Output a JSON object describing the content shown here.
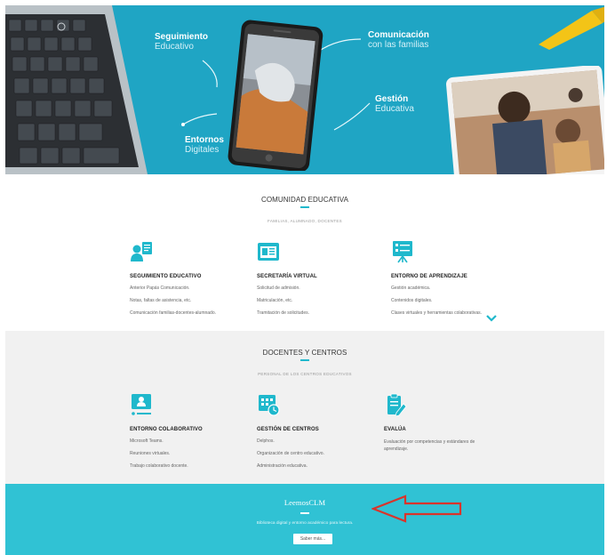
{
  "hero": {
    "labels": [
      {
        "strong": "Seguimiento",
        "light": "Educativo"
      },
      {
        "strong": "Comunicación",
        "light": "con las familias"
      },
      {
        "strong": "Gestión",
        "light": "Educativa"
      },
      {
        "strong": "Entornos",
        "light": "Digitales"
      }
    ]
  },
  "comunidad": {
    "title": "COMUNIDAD EDUCATIVA",
    "subtitle": "FAMILIAS, ALUMNADO, DOCENTES",
    "columns": [
      {
        "icon": "student-profile-icon",
        "title": "SEGUIMIENTO EDUCATIVO",
        "items": [
          "Anterior Papás Comunicación.",
          "Notas, faltas de asistencia, etc.",
          "Comunicación familias-docentes-alumnado."
        ]
      },
      {
        "icon": "virtual-secretary-icon",
        "title": "SECRETARÍA VIRTUAL",
        "items": [
          "Solicitud de admisión.",
          "Matriculación, etc.",
          "Tramitación de solicitudes."
        ]
      },
      {
        "icon": "learning-board-icon",
        "title": "ENTORNO DE APRENDIZAJE",
        "items": [
          "Gestión académica.",
          "Contenidos digitales.",
          "Clases virtuales y herramientas colaborativas."
        ]
      }
    ]
  },
  "docentes": {
    "title": "DOCENTES Y CENTROS",
    "subtitle": "PERSONAL DE LOS CENTROS EDUCATIVOS",
    "columns": [
      {
        "icon": "collaborative-screen-icon",
        "title": "ENTORNO COLABORATIVO",
        "items": [
          "Microsoft Teams.",
          "Reuniones virtuales.",
          "Trabajo colaborativo docente."
        ]
      },
      {
        "icon": "calendar-clock-icon",
        "title": "GESTIÓN DE CENTROS",
        "items": [
          "Delphos.",
          "Organización de centro educativo.",
          "Administración educativa."
        ]
      },
      {
        "icon": "clipboard-pencil-icon",
        "title": "EVALÚA",
        "items": [
          "Evaluación por competencias y estándares de aprendizaje."
        ]
      }
    ]
  },
  "leemos": {
    "title": "LeemosCLM",
    "description": "Biblioteca digital y entorno académico para lectura.",
    "button_label": "Saber más..."
  },
  "colors": {
    "hero_bg": "#1fa5c4",
    "accent": "#1fb8cc",
    "banner_bg": "#30c2d4",
    "annotation_arrow": "#d9342b"
  }
}
